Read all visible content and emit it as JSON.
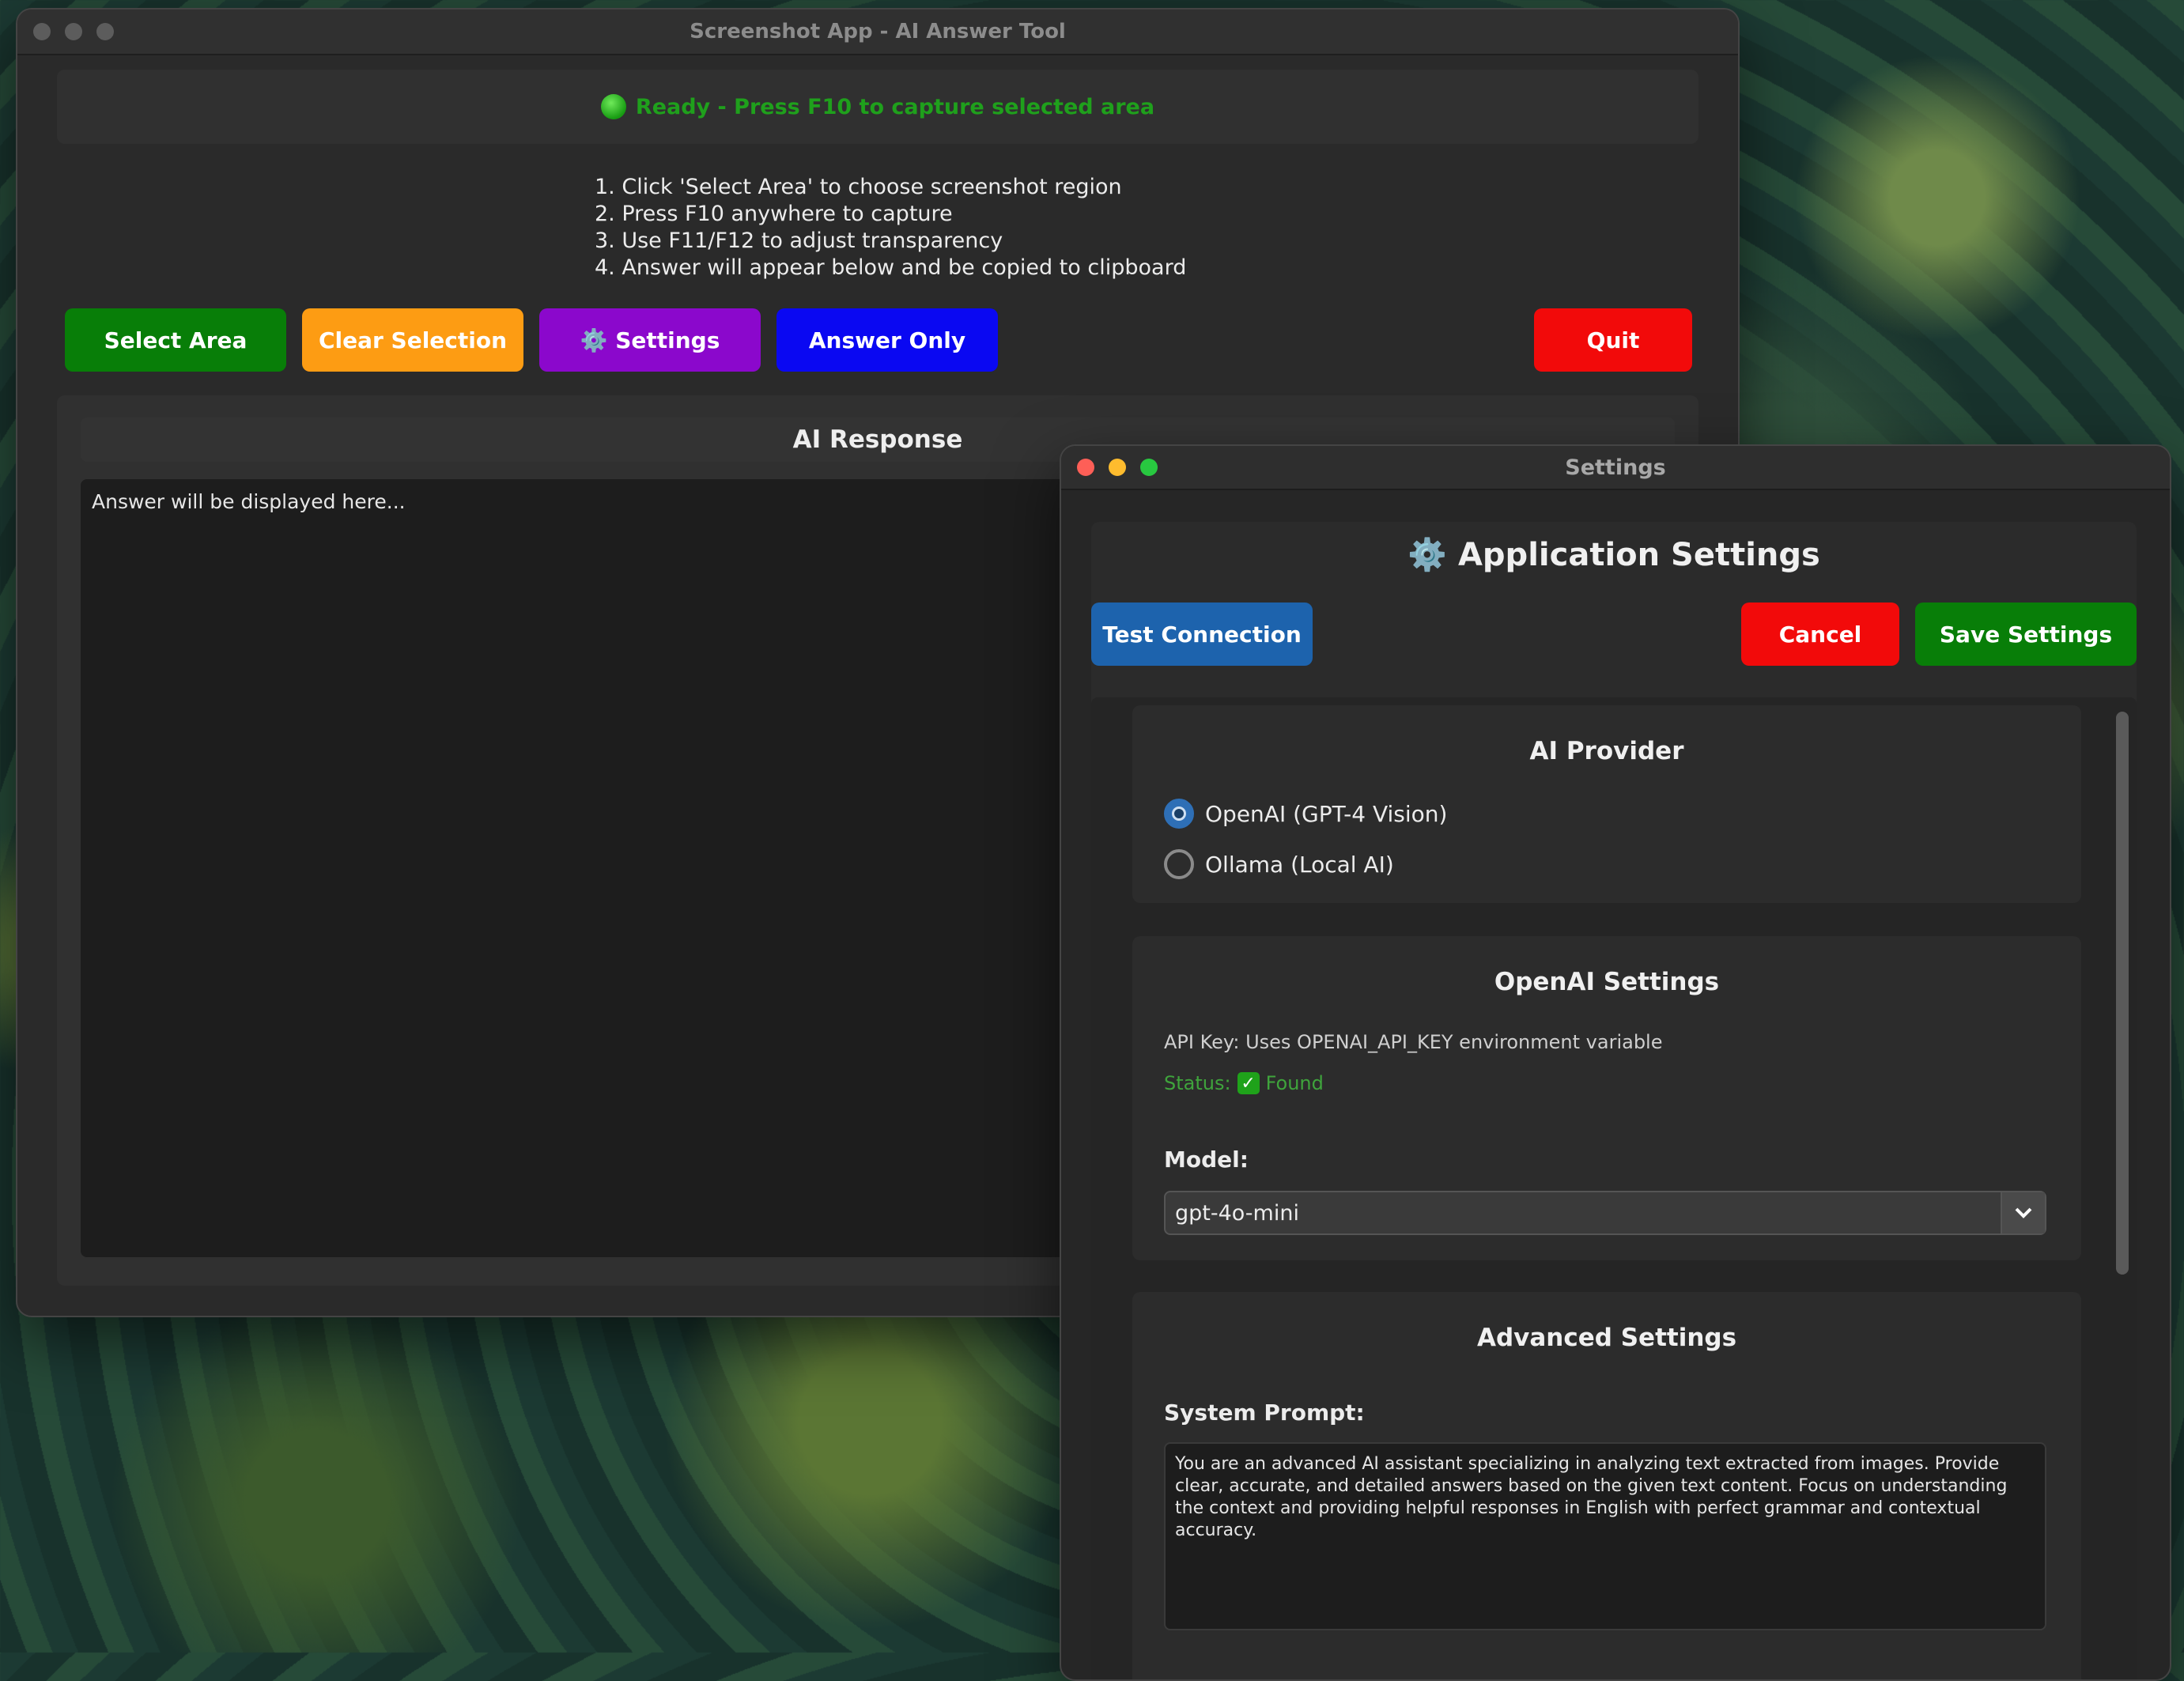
{
  "main": {
    "title": "Screenshot App - AI Answer Tool",
    "status": "Ready - Press F10 to capture selected area",
    "instructions": [
      "1. Click 'Select Area' to choose screenshot region",
      "2. Press F10 anywhere to capture",
      "3. Use F11/F12 to adjust transparency",
      "4. Answer will appear below and be copied to clipboard"
    ],
    "buttons": {
      "select_area": "Select Area",
      "clear_selection": "Clear Selection",
      "settings": "⚙️ Settings",
      "answer_only": "Answer Only",
      "quit": "Quit"
    },
    "response_title": "AI Response",
    "response_text": "Answer will be displayed here..."
  },
  "settings": {
    "title": "Settings",
    "heading": "Application Settings",
    "buttons": {
      "test_connection": "Test Connection",
      "cancel": "Cancel",
      "save": "Save Settings"
    },
    "provider": {
      "title": "AI Provider",
      "options": [
        "OpenAI (GPT-4 Vision)",
        "Ollama (Local AI)"
      ],
      "selected": "OpenAI (GPT-4 Vision)"
    },
    "openai": {
      "title": "OpenAI Settings",
      "api_key_note": "API Key: Uses OPENAI_API_KEY environment variable",
      "status_label": "Status:",
      "status_value": "Found",
      "model_label": "Model:",
      "model_value": "gpt-4o-mini"
    },
    "advanced": {
      "title": "Advanced Settings",
      "prompt_label": "System Prompt:",
      "prompt_value": "You are an advanced AI assistant specializing in analyzing text extracted from images. Provide clear, accurate, and detailed answers based on the given text content. Focus on understanding the context and providing helpful responses in English with perfect grammar and contextual accuracy."
    }
  },
  "colors": {
    "select_area": "#087e08",
    "clear_selection": "#fd9c13",
    "settings_btn": "#8b08cc",
    "answer_only": "#0a08f2",
    "quit": "#f20a0a",
    "test_connection": "#1d63ad",
    "save": "#087e08"
  }
}
